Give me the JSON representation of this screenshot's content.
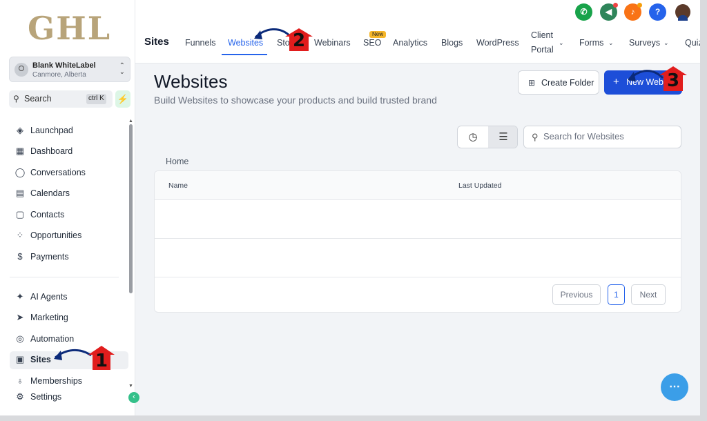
{
  "brand": {
    "logo": "GHL"
  },
  "account": {
    "name": "Blank WhiteLabel",
    "location": "Canmore, Alberta"
  },
  "sidebar": {
    "search_label": "Search",
    "search_shortcut": "ctrl K",
    "items": [
      {
        "label": "Launchpad",
        "icon": "rocket-icon"
      },
      {
        "label": "Dashboard",
        "icon": "grid-icon"
      },
      {
        "label": "Conversations",
        "icon": "chat-icon"
      },
      {
        "label": "Calendars",
        "icon": "calendar-icon"
      },
      {
        "label": "Contacts",
        "icon": "contacts-icon"
      },
      {
        "label": "Opportunities",
        "icon": "opportunities-icon"
      },
      {
        "label": "Payments",
        "icon": "payments-icon"
      },
      {
        "label": "AI Agents",
        "icon": "sparkles-icon"
      },
      {
        "label": "Marketing",
        "icon": "send-icon"
      },
      {
        "label": "Automation",
        "icon": "automation-icon"
      },
      {
        "label": "Sites",
        "icon": "sites-icon"
      },
      {
        "label": "Memberships",
        "icon": "badge-icon"
      },
      {
        "label": "Settings",
        "icon": "gear-icon"
      }
    ]
  },
  "header": {
    "title": "Sites",
    "tabs": [
      {
        "label": "Funnels"
      },
      {
        "label": "Websites"
      },
      {
        "label": "Sto"
      },
      {
        "label": "Webinars"
      },
      {
        "label": "SEO",
        "badge": "New"
      },
      {
        "label": "Analytics"
      },
      {
        "label": "Blogs"
      },
      {
        "label": "WordPress"
      },
      {
        "label": "Client Portal"
      },
      {
        "label": "Forms"
      },
      {
        "label": "Surveys"
      },
      {
        "label": "Quiz"
      }
    ]
  },
  "top_icons": {
    "phone": "phone-icon",
    "announce": "megaphone-icon",
    "notify": "bell-icon",
    "help": "?"
  },
  "page": {
    "title": "Websites",
    "subtitle": "Build Websites to showcase your products and build trusted brand",
    "create_folder_label": "Create Folder",
    "new_label": "New Webs",
    "search_placeholder": "Search for Websites",
    "breadcrumb": "Home",
    "columns": [
      "Name",
      "Last Updated"
    ],
    "pagination": {
      "previous": "Previous",
      "current": "1",
      "next": "Next"
    }
  },
  "annotations": [
    "1",
    "2",
    "3"
  ],
  "colors": {
    "accent": "#2563eb",
    "primary_button": "#1d4ed8",
    "annotation_red": "#e11d1d",
    "arrow_navy": "#0b2a7a"
  }
}
